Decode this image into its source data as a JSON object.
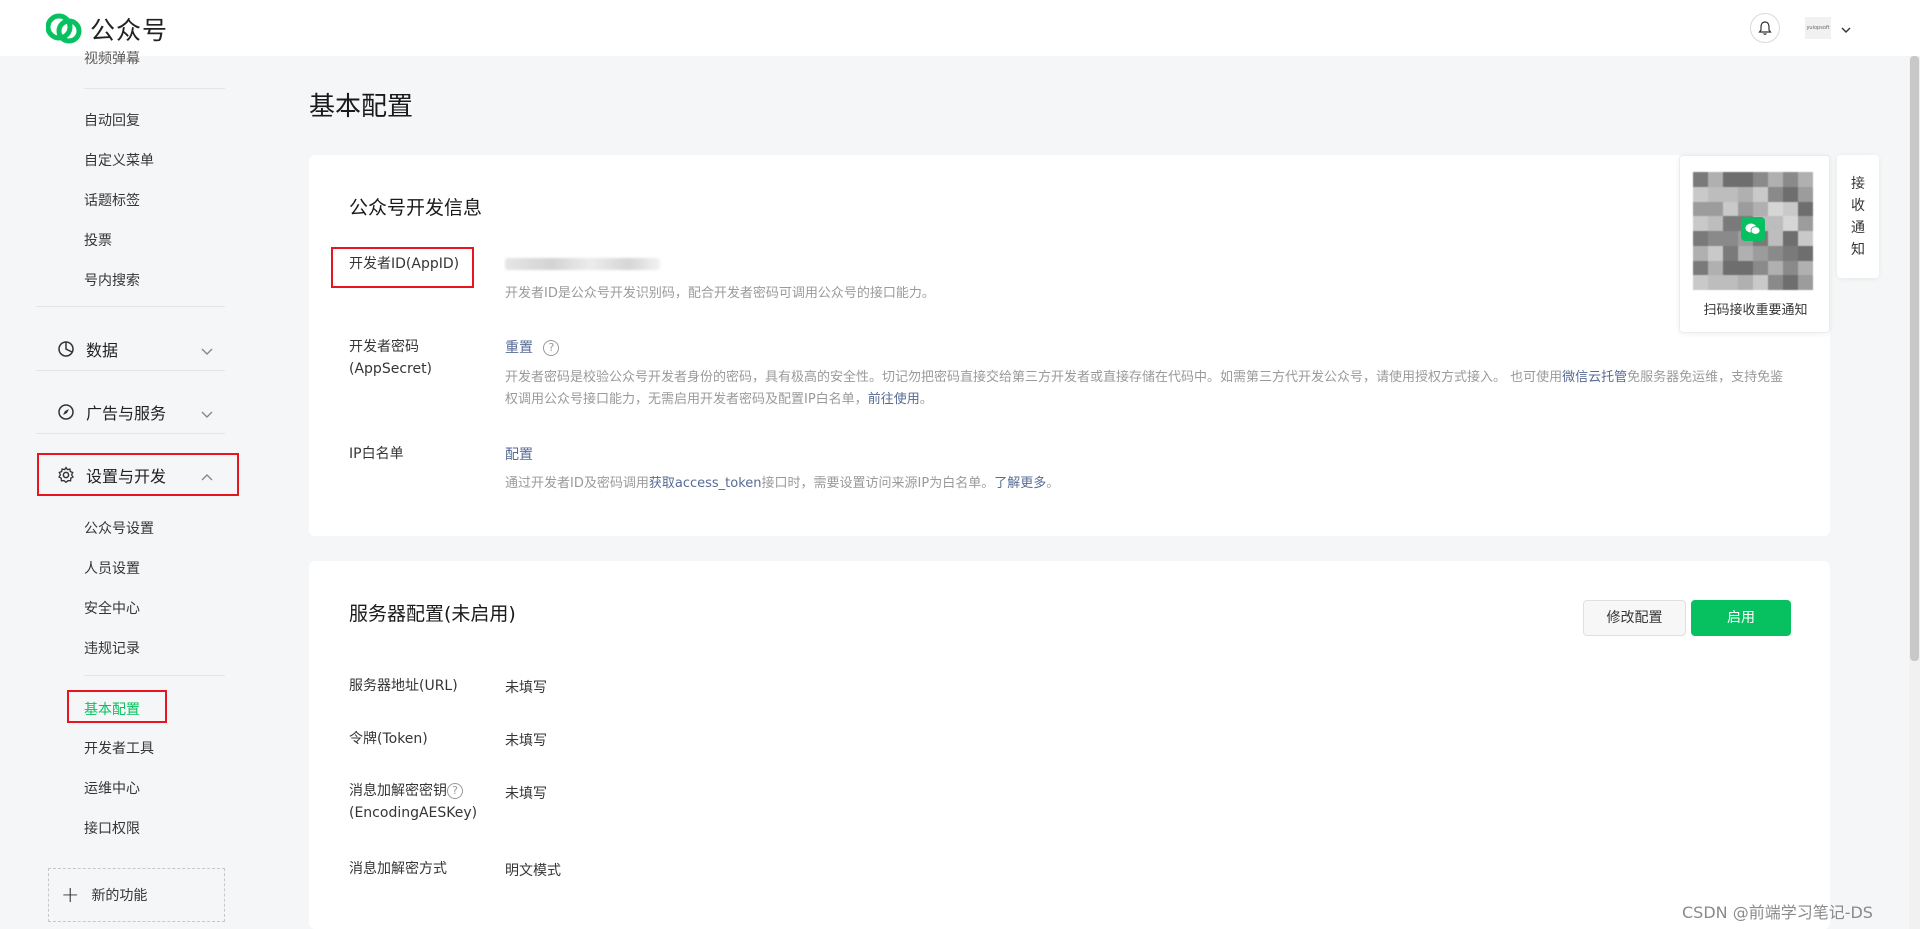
{
  "header": {
    "app_name": "公众号",
    "account_text": "yuiopsoft"
  },
  "sidebar": {
    "truncated_item": "视频弹幕",
    "items_top": [
      "自动回复",
      "自定义菜单",
      "话题标签",
      "投票",
      "号内搜索"
    ],
    "groups": {
      "data": "数据",
      "ads": "广告与服务",
      "settings": "设置与开发"
    },
    "items_settings": [
      "公众号设置",
      "人员设置",
      "安全中心",
      "违规记录"
    ],
    "items_dev": [
      "基本配置",
      "开发者工具",
      "运维中心",
      "接口权限"
    ],
    "new_feature": "新的功能"
  },
  "page": {
    "title": "基本配置"
  },
  "dev_info": {
    "title": "公众号开发信息",
    "appid_label": "开发者ID(AppID)",
    "appid_desc": "开发者ID是公众号开发识别码，配合开发者密码可调用公众号的接口能力。",
    "secret_label": "开发者密码(AppSecret)",
    "secret_action": "重置",
    "secret_help": "?",
    "secret_desc_1": "开发者密码是校验公众号开发者身份的密码，具有极高的安全性。切记勿把密码直接交给第三方开发者或直接存储在代码中。如需第三方代开发公众号，请使用授权方式接入。 也可使用",
    "secret_desc_link": "微信云托管",
    "secret_desc_2": "免服务器免运维，支持免鉴权调用公众号接口能力，无需启用开发者密码及配置IP白名单，",
    "secret_desc_link2": "前往使用",
    "secret_desc_end": "。",
    "ip_label": "IP白名单",
    "ip_action": "配置",
    "ip_desc_1": "通过开发者ID及密码调用",
    "ip_desc_link": "获取access_token",
    "ip_desc_2": "接口时，需要设置访问来源IP为白名单。",
    "ip_desc_link2": "了解更多",
    "ip_desc_end": "。"
  },
  "server_config": {
    "title": "服务器配置(未启用)",
    "modify_button": "修改配置",
    "enable_button": "启用",
    "url_label": "服务器地址(URL)",
    "url_value": "未填写",
    "token_label": "令牌(Token)",
    "token_value": "未填写",
    "aes_label_1": "消息加解密密钥",
    "aes_label_2": "(EncodingAESKey)",
    "aes_help": "?",
    "aes_value": "未填写",
    "mode_label": "消息加解密方式",
    "mode_value": "明文模式"
  },
  "qr_panel": {
    "caption": "扫码接收重要通知",
    "tab_chars": [
      "接",
      "收",
      "通",
      "知"
    ]
  },
  "watermark": "CSDN @前端学习笔记-DS",
  "colors": {
    "accent": "#07c160",
    "link": "#576b95",
    "annotation_red": "#e8141f"
  }
}
